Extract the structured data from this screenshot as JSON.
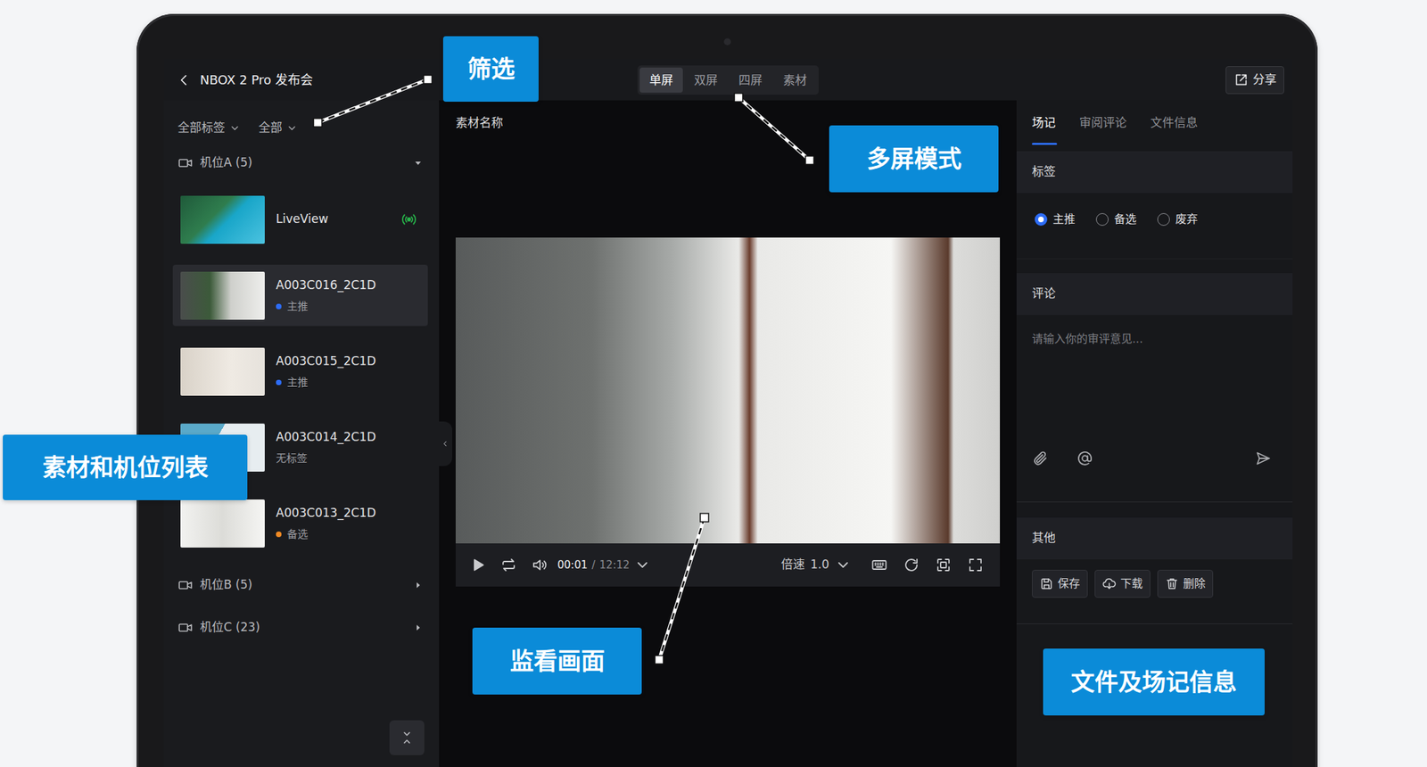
{
  "topbar": {
    "title": "NBOX 2 Pro 发布会",
    "view_tabs": [
      {
        "label": "单屏",
        "selected": true
      },
      {
        "label": "双屏",
        "selected": false
      },
      {
        "label": "四屏",
        "selected": false
      },
      {
        "label": "素材",
        "selected": false
      }
    ],
    "share": "分享"
  },
  "sidebar": {
    "filters": [
      "全部标签",
      "全部"
    ],
    "groups": [
      {
        "name": "机位A (5)",
        "expanded": true,
        "items": [
          {
            "kind": "live",
            "name": "LiveView",
            "selected": false
          },
          {
            "kind": "tagged",
            "name": "A003C016_2C1D",
            "tag": "主推",
            "color": "#2d6cf6",
            "selected": true
          },
          {
            "kind": "tagged",
            "name": "A003C015_2C1D",
            "tag": "主推",
            "color": "#2d6cf6",
            "selected": false
          },
          {
            "kind": "untagged",
            "name": "A003C014_2C1D",
            "tag": "无标签",
            "selected": false
          },
          {
            "kind": "tagged",
            "name": "A003C013_2C1D",
            "tag": "备选",
            "color": "#f08a24",
            "selected": false
          }
        ]
      },
      {
        "name": "机位B (5)",
        "expanded": false
      },
      {
        "name": "机位C (23)",
        "expanded": false
      }
    ]
  },
  "player": {
    "title": "素材名称",
    "time_current": "00:01",
    "time_separator": "/",
    "time_total": "12:12",
    "speed_label": "倍速",
    "speed": "1.0"
  },
  "panel": {
    "tabs": [
      {
        "label": "场记",
        "selected": true
      },
      {
        "label": "审阅评论",
        "selected": false
      },
      {
        "label": "文件信息",
        "selected": false
      }
    ],
    "tag_section": {
      "title": "标签",
      "options": [
        {
          "label": "主推",
          "selected": true
        },
        {
          "label": "备选",
          "selected": false
        },
        {
          "label": "废弃",
          "selected": false
        }
      ]
    },
    "comment_section": {
      "title": "评论",
      "placeholder": "请输入你的审评意见..."
    },
    "other_section": {
      "title": "其他",
      "buttons": [
        "保存",
        "下载",
        "删除"
      ]
    }
  },
  "callouts": [
    "筛选",
    "多屏模式",
    "素材和机位列表",
    "监看画面",
    "文件及场记信息"
  ]
}
